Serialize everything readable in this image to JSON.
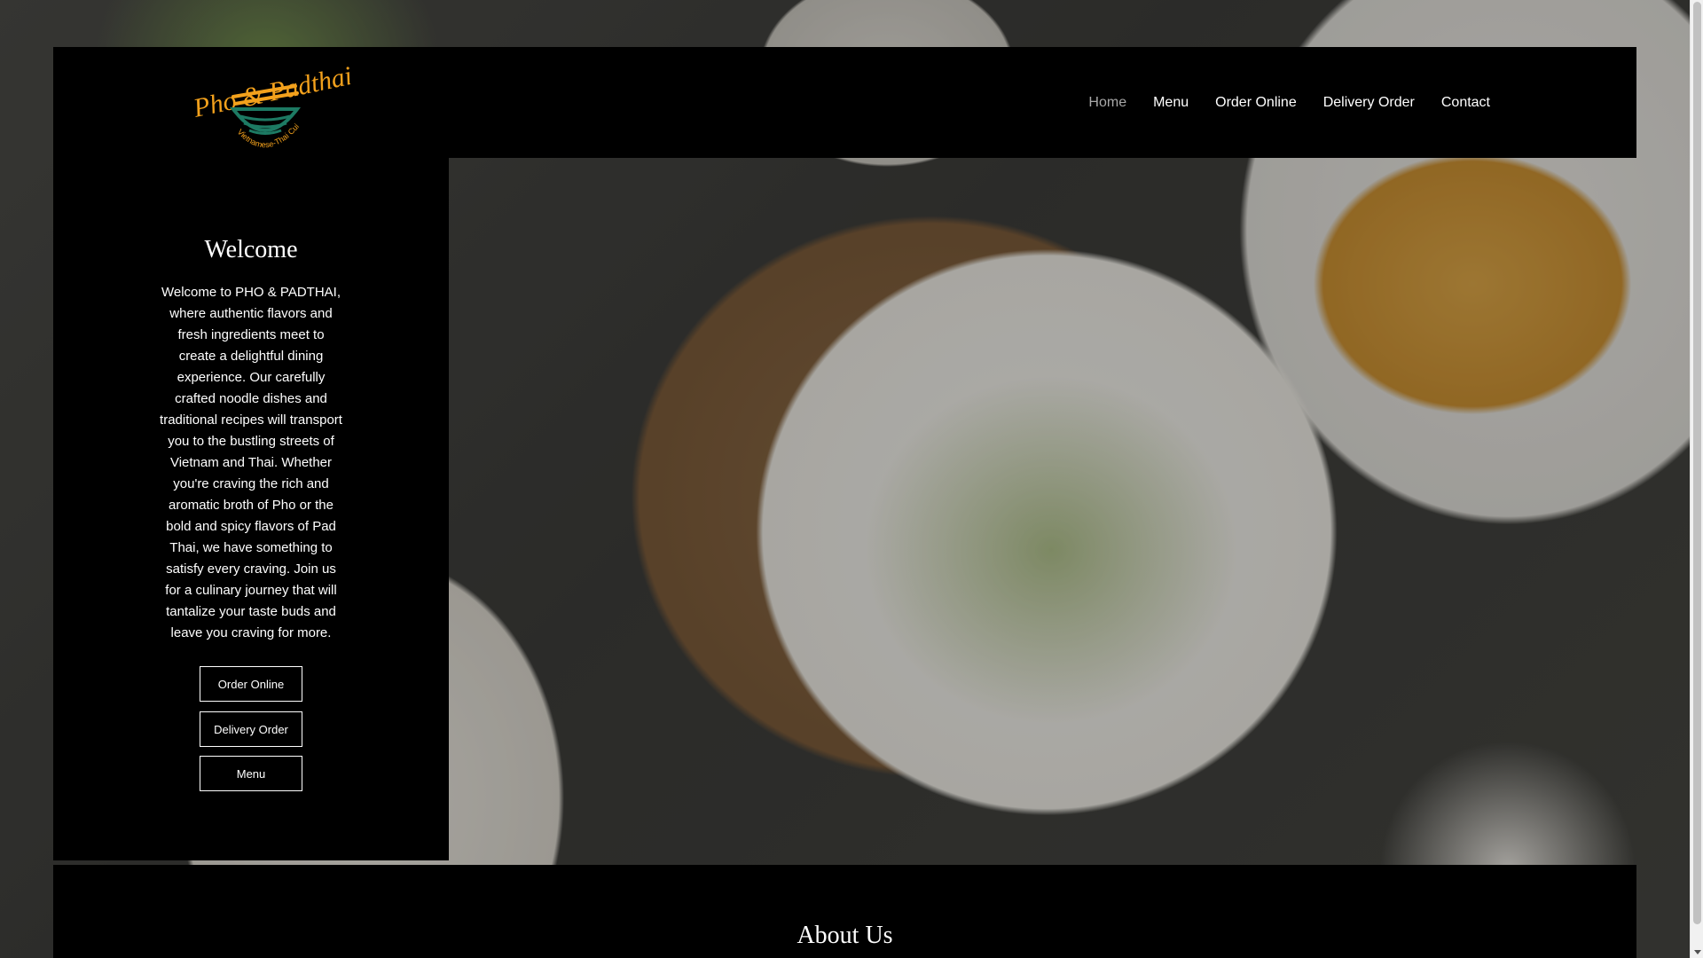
{
  "brand": {
    "logo_text": "Pho & Padthai",
    "logo_tagline": "Vietnamese-Thai Cuisine",
    "accent_color": "#f3a11c",
    "bowl_color": "#1d7a63"
  },
  "nav": {
    "items": [
      {
        "label": "Home",
        "active": true
      },
      {
        "label": "Menu"
      },
      {
        "label": "Order Online"
      },
      {
        "label": "Delivery Order"
      },
      {
        "label": "Contact"
      }
    ]
  },
  "welcome": {
    "title": "Welcome",
    "body": "Welcome to PHO & PADTHAI, where authentic flavors and fresh ingredients meet to create a delightful dining experience. Our carefully crafted noodle dishes and traditional recipes will transport you to the bustling streets of Vietnam and Thai. Whether you're craving the rich and aromatic broth of Pho or the bold and spicy flavors of Pad Thai, we have something to satisfy every craving. Join us for a culinary journey that will tantalize your taste buds and leave you craving for more.",
    "buttons": {
      "order_online": "Order Online",
      "delivery_order": "Delivery Order",
      "menu": "Menu"
    }
  },
  "about": {
    "title": "About Us"
  },
  "background": {
    "image_icon": "pho-bowl-photo"
  }
}
